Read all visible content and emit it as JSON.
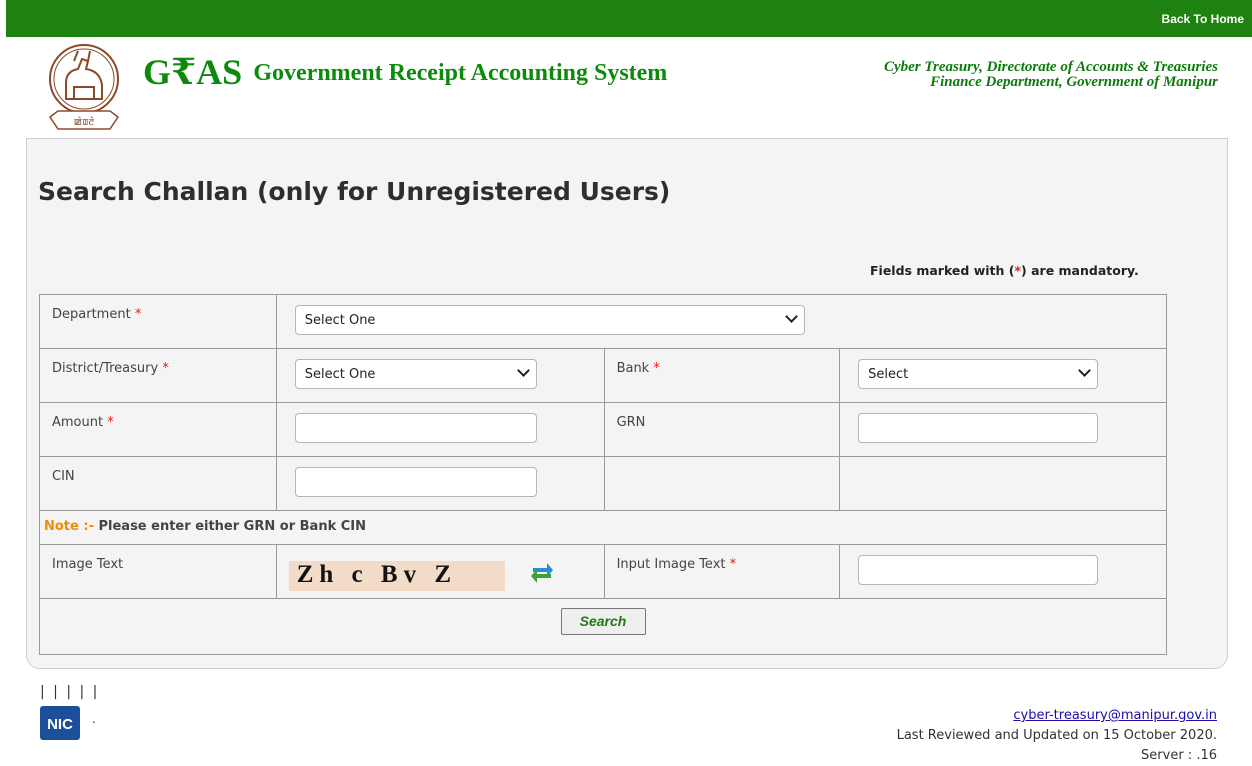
{
  "topbar": {
    "back_home": "Back To Home",
    "color": "#1e8211"
  },
  "header": {
    "logo_text": "GRAS",
    "logo_rupee": "₹",
    "tagline": "Government Receipt Accounting System",
    "dept_line1": "Cyber Treasury, Directorate of Accounts & Treasuries",
    "dept_line2": "Finance Department, Government of Manipur",
    "emblem_caption": "ꯀꯥꯡꯂꯥ"
  },
  "page": {
    "title": "Search Challan (only for Unregistered Users)",
    "mandatory_prefix": "Fields marked with (",
    "mandatory_star": "*",
    "mandatory_suffix": ") are mandatory."
  },
  "form": {
    "department_label": "Department",
    "department_value": "Select One",
    "district_label": "District/Treasury",
    "district_value": "Select One",
    "bank_label": "Bank",
    "bank_value": "Select",
    "amount_label": "Amount",
    "grn_label": "GRN",
    "cin_label": "CIN",
    "note_prefix": "Note :-",
    "note_text": " Please enter either GRN or Bank CIN",
    "image_text_label": "Image Text",
    "captcha_text": "Zh c Bv Z",
    "input_image_text_label": "Input Image Text",
    "required_star": "*",
    "search_button": "Search"
  },
  "footer": {
    "pipes": "| | | | |",
    "dot": ".",
    "email": "cyber-treasury@manipur.gov.in",
    "reviewed": "Last Reviewed and Updated on 15 October 2020.",
    "server": "Server : .16"
  }
}
